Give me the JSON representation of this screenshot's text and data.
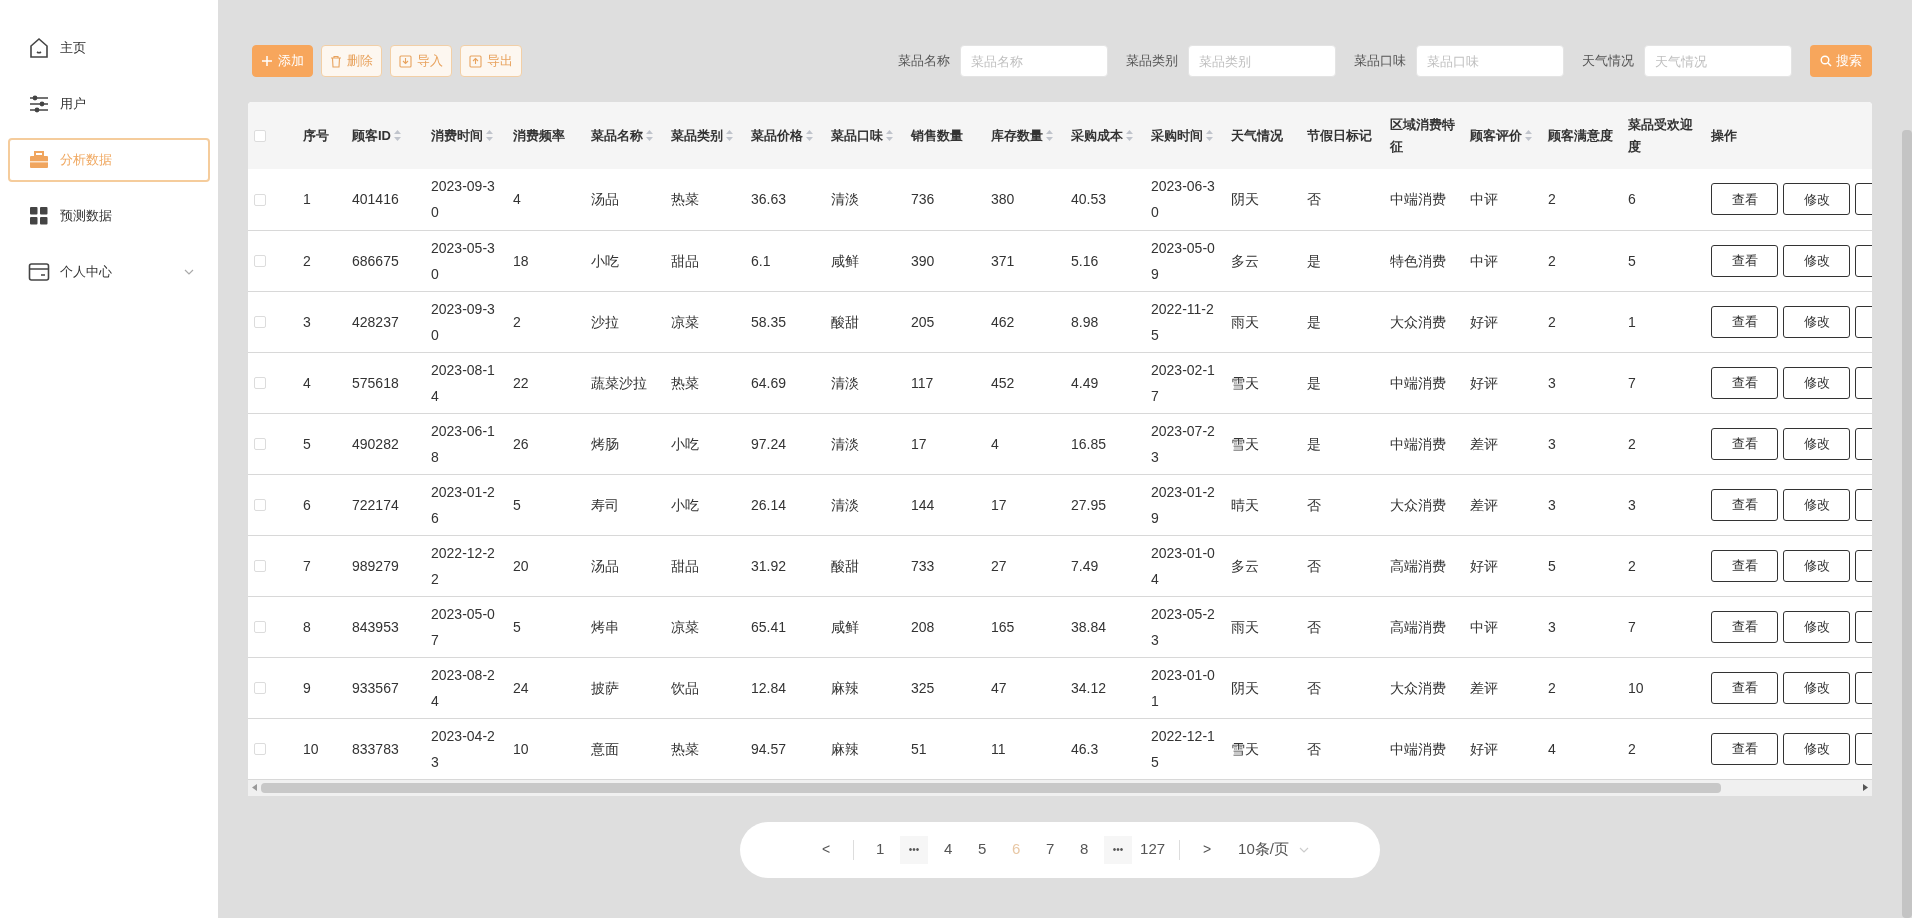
{
  "sidebar": {
    "items": [
      {
        "label": "主页",
        "selected": false,
        "has_submenu": false
      },
      {
        "label": "用户",
        "selected": false,
        "has_submenu": false
      },
      {
        "label": "分析数据",
        "selected": true,
        "has_submenu": false
      },
      {
        "label": "预测数据",
        "selected": false,
        "has_submenu": false
      },
      {
        "label": "个人中心",
        "selected": false,
        "has_submenu": true
      }
    ]
  },
  "toolbar": {
    "buttons": [
      {
        "label": "添加",
        "kind": "primary"
      },
      {
        "label": "删除",
        "kind": "outline"
      },
      {
        "label": "导入",
        "kind": "outline"
      },
      {
        "label": "导出",
        "kind": "outline"
      }
    ],
    "filters": [
      {
        "label": "菜品名称",
        "placeholder": "菜品名称"
      },
      {
        "label": "菜品类别",
        "placeholder": "菜品类别"
      },
      {
        "label": "菜品口味",
        "placeholder": "菜品口味"
      },
      {
        "label": "天气情况",
        "placeholder": "天气情况"
      }
    ],
    "search_button": "搜索"
  },
  "table": {
    "select_all_checked": false,
    "columns": [
      {
        "label": "序号",
        "kind": "plain"
      },
      {
        "label": "顾客ID",
        "kind": "sortable"
      },
      {
        "label": "消费时间",
        "kind": "sortable"
      },
      {
        "label": "消费频率",
        "kind": "plain"
      },
      {
        "label": "菜品名称",
        "kind": "sortable"
      },
      {
        "label": "菜品类别",
        "kind": "sortable"
      },
      {
        "label": "菜品价格",
        "kind": "sortable"
      },
      {
        "label": "菜品口味",
        "kind": "sortable"
      },
      {
        "label": "销售数量",
        "kind": "plain"
      },
      {
        "label": "库存数量",
        "kind": "sortable"
      },
      {
        "label": "采购成本",
        "kind": "sortable"
      },
      {
        "label": "采购时间",
        "kind": "sortable"
      },
      {
        "label": "天气情况",
        "kind": "plain"
      },
      {
        "label": "节假日标记",
        "kind": "plain"
      },
      {
        "label": "区域消费特征",
        "kind": "plain"
      },
      {
        "label": "顾客评价",
        "kind": "sortable"
      },
      {
        "label": "顾客满意度",
        "kind": "plain"
      },
      {
        "label": "菜品受欢迎度",
        "kind": "plain"
      },
      {
        "label": "操作",
        "kind": "plain"
      }
    ],
    "rows": [
      {
        "checked": false,
        "actions": [
          "查看",
          "修改"
        ],
        "cells": [
          "1",
          "401416",
          "2023-09-30",
          "4",
          "汤品",
          "热菜",
          "36.63",
          "清淡",
          "736",
          "380",
          "40.53",
          "2023-06-30",
          "阴天",
          "否",
          "中端消费",
          "中评",
          "2",
          "6"
        ]
      },
      {
        "checked": false,
        "actions": [
          "查看",
          "修改"
        ],
        "cells": [
          "2",
          "686675",
          "2023-05-30",
          "18",
          "小吃",
          "甜品",
          "6.1",
          "咸鲜",
          "390",
          "371",
          "5.16",
          "2023-05-09",
          "多云",
          "是",
          "特色消费",
          "中评",
          "2",
          "5"
        ]
      },
      {
        "checked": false,
        "actions": [
          "查看",
          "修改"
        ],
        "cells": [
          "3",
          "428237",
          "2023-09-30",
          "2",
          "沙拉",
          "凉菜",
          "58.35",
          "酸甜",
          "205",
          "462",
          "8.98",
          "2022-11-25",
          "雨天",
          "是",
          "大众消费",
          "好评",
          "2",
          "1"
        ]
      },
      {
        "checked": false,
        "actions": [
          "查看",
          "修改"
        ],
        "cells": [
          "4",
          "575618",
          "2023-08-14",
          "22",
          "蔬菜沙拉",
          "热菜",
          "64.69",
          "清淡",
          "117",
          "452",
          "4.49",
          "2023-02-17",
          "雪天",
          "是",
          "中端消费",
          "好评",
          "3",
          "7"
        ]
      },
      {
        "checked": false,
        "actions": [
          "查看",
          "修改"
        ],
        "cells": [
          "5",
          "490282",
          "2023-06-18",
          "26",
          "烤肠",
          "小吃",
          "97.24",
          "清淡",
          "17",
          "4",
          "16.85",
          "2023-07-23",
          "雪天",
          "是",
          "中端消费",
          "差评",
          "3",
          "2"
        ]
      },
      {
        "checked": false,
        "actions": [
          "查看",
          "修改"
        ],
        "cells": [
          "6",
          "722174",
          "2023-01-26",
          "5",
          "寿司",
          "小吃",
          "26.14",
          "清淡",
          "144",
          "17",
          "27.95",
          "2023-01-29",
          "晴天",
          "否",
          "大众消费",
          "差评",
          "3",
          "3"
        ]
      },
      {
        "checked": false,
        "actions": [
          "查看",
          "修改"
        ],
        "cells": [
          "7",
          "989279",
          "2022-12-22",
          "20",
          "汤品",
          "甜品",
          "31.92",
          "酸甜",
          "733",
          "27",
          "7.49",
          "2023-01-04",
          "多云",
          "否",
          "高端消费",
          "好评",
          "5",
          "2"
        ]
      },
      {
        "checked": false,
        "actions": [
          "查看",
          "修改"
        ],
        "cells": [
          "8",
          "843953",
          "2023-05-07",
          "5",
          "烤串",
          "凉菜",
          "65.41",
          "咸鲜",
          "208",
          "165",
          "38.84",
          "2023-05-23",
          "雨天",
          "否",
          "高端消费",
          "中评",
          "3",
          "7"
        ]
      },
      {
        "checked": false,
        "actions": [
          "查看",
          "修改"
        ],
        "cells": [
          "9",
          "933567",
          "2023-08-24",
          "24",
          "披萨",
          "饮品",
          "12.84",
          "麻辣",
          "325",
          "47",
          "34.12",
          "2023-01-01",
          "阴天",
          "否",
          "大众消费",
          "差评",
          "2",
          "10"
        ]
      },
      {
        "checked": false,
        "actions": [
          "查看",
          "修改"
        ],
        "cells": [
          "10",
          "833783",
          "2023-04-23",
          "10",
          "意面",
          "热菜",
          "94.57",
          "麻辣",
          "51",
          "11",
          "46.3",
          "2022-12-15",
          "雪天",
          "否",
          "中端消费",
          "好评",
          "4",
          "2"
        ]
      }
    ]
  },
  "pagination": {
    "prev": "<",
    "next": ">",
    "pages": [
      {
        "label": "1",
        "kind": "page",
        "selected": false
      },
      {
        "label": "•••",
        "kind": "ellipsis",
        "selected": false
      },
      {
        "label": "4",
        "kind": "page",
        "selected": false
      },
      {
        "label": "5",
        "kind": "page",
        "selected": false
      },
      {
        "label": "6",
        "kind": "page",
        "selected": true
      },
      {
        "label": "7",
        "kind": "page",
        "selected": false
      },
      {
        "label": "8",
        "kind": "page",
        "selected": false
      },
      {
        "label": "•••",
        "kind": "ellipsis",
        "selected": false
      },
      {
        "label": "127",
        "kind": "page",
        "selected": false
      }
    ],
    "page_size": "10条/页"
  }
}
